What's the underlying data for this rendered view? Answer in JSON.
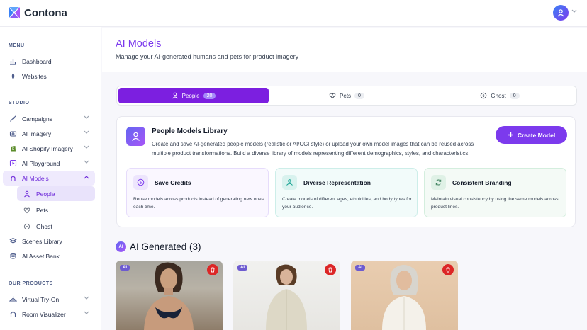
{
  "app": {
    "name": "Contona"
  },
  "sidebar": {
    "sections": {
      "menu": "MENU",
      "studio": "STUDIO",
      "products": "OUR PRODUCTS"
    },
    "menu_items": [
      {
        "label": "Dashboard",
        "icon": "bar-chart-icon"
      },
      {
        "label": "Websites",
        "icon": "websites-icon"
      }
    ],
    "studio_items": [
      {
        "label": "Campaigns",
        "icon": "campaigns-icon"
      },
      {
        "label": "AI Imagery",
        "icon": "imagery-icon"
      },
      {
        "label": "AI Shopify Imagery",
        "icon": "shopify-icon"
      },
      {
        "label": "AI Playground",
        "icon": "playground-icon"
      },
      {
        "label": "AI Models",
        "icon": "models-icon"
      }
    ],
    "sub_items": [
      {
        "label": "People",
        "icon": "person-icon"
      },
      {
        "label": "Pets",
        "icon": "heart-icon"
      },
      {
        "label": "Ghost",
        "icon": "ghost-icon"
      }
    ],
    "studio_items_after": [
      {
        "label": "Scenes Library",
        "icon": "layers-icon"
      },
      {
        "label": "AI Asset Bank",
        "icon": "database-icon"
      }
    ],
    "product_items": [
      {
        "label": "Virtual Try-On",
        "icon": "hanger-icon"
      },
      {
        "label": "Room Visualizer",
        "icon": "home-icon"
      }
    ]
  },
  "header": {
    "title": "AI Models",
    "subtitle": "Manage your AI-generated humans and pets for product imagery"
  },
  "tabs": [
    {
      "label": "People",
      "count": "20"
    },
    {
      "label": "Pets",
      "count": "0"
    },
    {
      "label": "Ghost",
      "count": "0"
    }
  ],
  "library": {
    "title": "People Models Library",
    "description": "Create and save AI-generated people models (realistic or AI/CGI style) or upload your own model images that can be reused across multiple product transformations. Build a diverse library of models representing different demographics, styles, and characteristics.",
    "create_label": "Create Model"
  },
  "features": [
    {
      "title": "Save Credits",
      "desc": "Reuse models across products instead of generating new ones each time."
    },
    {
      "title": "Diverse Representation",
      "desc": "Create models of different ages, ethnicities, and body types for your audience."
    },
    {
      "title": "Consistent Branding",
      "desc": "Maintain visual consistency by using the same models across product lines."
    }
  ],
  "generated": {
    "pill": "AI",
    "title": "AI Generated (3)",
    "tag": "AI"
  },
  "colors": {
    "accent": "#7c3aed",
    "tab_active": "#7c1fe0",
    "delete": "#dc2626"
  }
}
